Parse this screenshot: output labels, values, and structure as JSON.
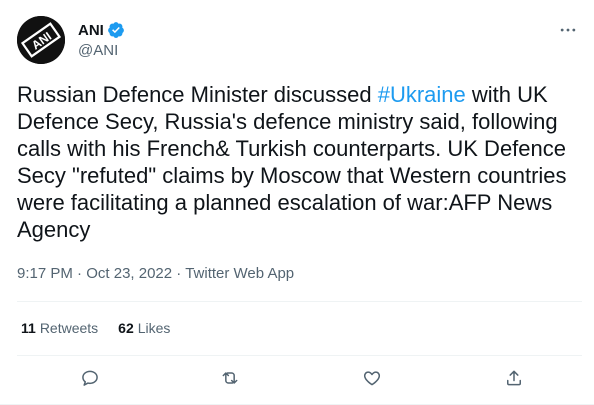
{
  "user": {
    "display_name": "ANI",
    "handle": "@ANI",
    "avatar_text": "ANI",
    "verified": true
  },
  "tweet": {
    "text_before": "Russian Defence Minister discussed ",
    "hashtag": "#Ukraine",
    "text_after": " with UK Defence Secy, Russia's defence ministry said, following calls with his French& Turkish counterparts. UK Defence Secy \"refuted\" claims by Moscow that Western countries were facilitating a planned escalation of war:AFP News Agency"
  },
  "meta": {
    "time": "9:17 PM",
    "separator": "·",
    "date": "Oct 23, 2022",
    "source": "Twitter Web App"
  },
  "stats": {
    "retweets_count": "11",
    "retweets_label": "Retweets",
    "likes_count": "62",
    "likes_label": "Likes"
  },
  "icons": {
    "more": "more-horizontal-icon",
    "reply": "reply-icon",
    "retweet": "retweet-icon",
    "like": "heart-icon",
    "share": "share-icon",
    "verified": "verified-badge-icon"
  },
  "colors": {
    "text": "#0f1419",
    "secondary": "#536471",
    "accent": "#1d9bf0",
    "divider": "#eff3f4"
  }
}
